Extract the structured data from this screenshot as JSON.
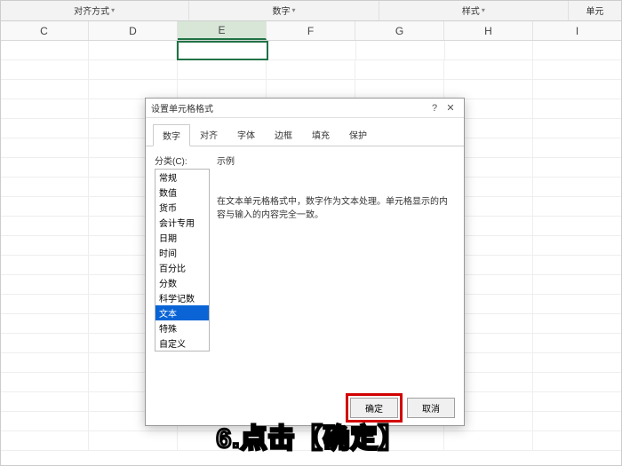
{
  "ribbon": {
    "groups": [
      "对齐方式",
      "数字",
      "样式",
      "单元"
    ]
  },
  "columns": [
    "C",
    "D",
    "E",
    "F",
    "G",
    "H",
    "I"
  ],
  "activeColumnIndex": 2,
  "dialog": {
    "title": "设置单元格格式",
    "tabs": [
      "数字",
      "对齐",
      "字体",
      "边框",
      "填充",
      "保护"
    ],
    "activeTab": 0,
    "category_label": "分类(C):",
    "categories": [
      "常规",
      "数值",
      "货币",
      "会计专用",
      "日期",
      "时间",
      "百分比",
      "分数",
      "科学记数",
      "文本",
      "特殊",
      "自定义"
    ],
    "selectedCategoryIndex": 9,
    "example_label": "示例",
    "description": "在文本单元格格式中，数字作为文本处理。单元格显示的内容与输入的内容完全一致。",
    "ok_label": "确定",
    "cancel_label": "取消"
  },
  "caption": "6.点击【确定】"
}
